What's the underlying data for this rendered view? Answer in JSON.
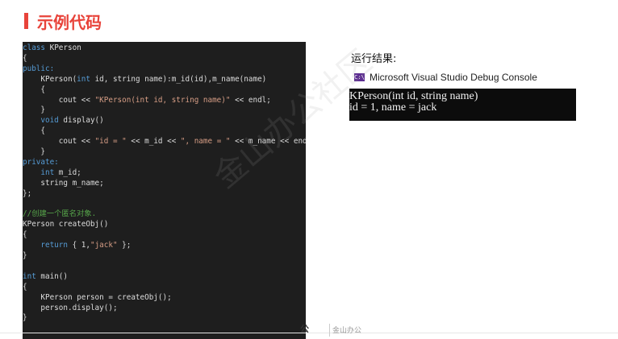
{
  "title": "示例代码",
  "code": [
    [
      {
        "t": "class",
        "c": "kw"
      },
      {
        "t": " KPerson",
        "c": ""
      }
    ],
    [
      {
        "t": "{",
        "c": ""
      }
    ],
    [
      {
        "t": "public:",
        "c": "kw"
      }
    ],
    [
      {
        "t": "    KPerson(",
        "c": ""
      },
      {
        "t": "int",
        "c": "kw"
      },
      {
        "t": " id, string name):m_id(id),m_name(name)",
        "c": ""
      }
    ],
    [
      {
        "t": "    {",
        "c": ""
      }
    ],
    [
      {
        "t": "        cout << ",
        "c": ""
      },
      {
        "t": "\"KPerson(int id, string name)\"",
        "c": "str"
      },
      {
        "t": " << endl;",
        "c": ""
      }
    ],
    [
      {
        "t": "    }",
        "c": ""
      }
    ],
    [
      {
        "t": "    ",
        "c": ""
      },
      {
        "t": "void",
        "c": "kw"
      },
      {
        "t": " display()",
        "c": ""
      }
    ],
    [
      {
        "t": "    {",
        "c": ""
      }
    ],
    [
      {
        "t": "        cout << ",
        "c": ""
      },
      {
        "t": "\"id = \"",
        "c": "str"
      },
      {
        "t": " << m_id << ",
        "c": ""
      },
      {
        "t": "\", name = \"",
        "c": "str"
      },
      {
        "t": " << m_name << endl;",
        "c": ""
      }
    ],
    [
      {
        "t": "    }",
        "c": ""
      }
    ],
    [
      {
        "t": "private:",
        "c": "kw"
      }
    ],
    [
      {
        "t": "    ",
        "c": ""
      },
      {
        "t": "int",
        "c": "kw"
      },
      {
        "t": " m_id;",
        "c": ""
      }
    ],
    [
      {
        "t": "    string m_name;",
        "c": ""
      }
    ],
    [
      {
        "t": "};",
        "c": ""
      }
    ],
    [],
    [
      {
        "t": "//创建一个匿名对象.",
        "c": "cm"
      }
    ],
    [
      {
        "t": "KPerson createObj()",
        "c": ""
      }
    ],
    [
      {
        "t": "{",
        "c": ""
      }
    ],
    [
      {
        "t": "    ",
        "c": ""
      },
      {
        "t": "return",
        "c": "kw"
      },
      {
        "t": " { 1,",
        "c": ""
      },
      {
        "t": "\"jack\"",
        "c": "str"
      },
      {
        "t": " };",
        "c": ""
      }
    ],
    [
      {
        "t": "}",
        "c": ""
      }
    ],
    [],
    [
      {
        "t": "int",
        "c": "kw"
      },
      {
        "t": " main()",
        "c": ""
      }
    ],
    [
      {
        "t": "{",
        "c": ""
      }
    ],
    [
      {
        "t": "    KPerson person = createObj();",
        "c": ""
      }
    ],
    [
      {
        "t": "    person.display();",
        "c": ""
      }
    ],
    [
      {
        "t": "}",
        "c": ""
      }
    ]
  ],
  "result": {
    "label": "运行结果:",
    "console_title": "Microsoft Visual Studio Debug Console",
    "console_icon": "C:\\",
    "output": [
      "KPerson(int id, string name)",
      "id = 1, name = jack"
    ]
  },
  "watermark": "金山办公社区",
  "footer": {
    "logo": "公",
    "brand": "金山办公"
  },
  "colors": {
    "accent": "#e8433a",
    "code_bg": "#1e1e1e",
    "keyword": "#569cd6",
    "string": "#d69d85",
    "comment": "#57a64a",
    "console_icon": "#5c2d91"
  }
}
